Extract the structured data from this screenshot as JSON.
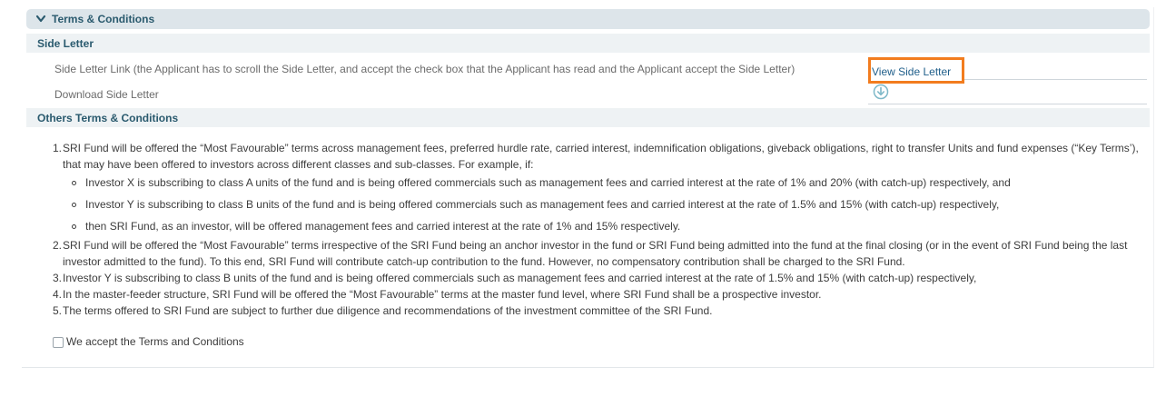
{
  "header": {
    "title": "Terms & Conditions",
    "icon": "chevron-down-icon"
  },
  "side_letter": {
    "section_title": "Side Letter",
    "link_row_label": "Side Letter Link (the Applicant has to scroll the Side Letter, and accept the check box that the Applicant has read and the Applicant accept the Side Letter)",
    "view_link_label": "View Side Letter",
    "download_row_label": "Download Side Letter",
    "download_icon": "download-circle-icon"
  },
  "others": {
    "section_title": "Others Terms & Conditions",
    "items": [
      {
        "num": "1.",
        "text": "SRI Fund will be offered the “Most Favourable” terms across management fees, preferred hurdle rate, carried interest, indemnification obligations, giveback obligations, right to transfer Units and fund expenses (“Key Terms’), that may have been offered to investors across different classes and sub-classes. For example, if:"
      },
      {
        "num": "2.",
        "text": "SRI Fund will be offered the “Most Favourable” terms irrespective of the SRI Fund being an anchor investor in the fund or SRI Fund being admitted into the fund at the final closing (or in the event of SRI Fund being the last investor admitted to the fund). To this end, SRI Fund will contribute catch-up contribution to the fund. However, no compensatory contribution shall be charged to the SRI Fund."
      },
      {
        "num": "3.",
        "text": "Investor Y is subscribing to class B units of the fund and is being offered commercials such as management fees and carried interest at the rate of 1.5% and 15% (with catch-up) respectively,"
      },
      {
        "num": "4.",
        "text": "In the master-feeder structure, SRI Fund will be offered the “Most Favourable” terms at the master fund level, where SRI Fund shall be a prospective investor."
      },
      {
        "num": "5.",
        "text": "The terms offered to SRI Fund are subject to further due diligence and recommendations of the investment committee of the SRI Fund."
      }
    ],
    "sub_items": [
      "Investor X is subscribing to class A units of the fund and is being offered commercials such as management fees and carried interest at the rate of 1% and 20% (with catch-up) respectively, and",
      "Investor Y is subscribing to class B units of the fund and is being offered commercials such as management fees and carried interest at the rate of 1.5% and 15% (with catch-up) respectively,",
      "then SRI Fund, as an investor, will be offered management fees and carried interest at the rate of 1% and 15% respectively."
    ]
  },
  "accept": {
    "label": "We accept the Terms and Conditions",
    "checked": false
  },
  "colors": {
    "header_bg": "#dde5ea",
    "heading_text": "#2a5a6e",
    "link": "#1f5e8a",
    "highlight": "#f27c1e"
  }
}
